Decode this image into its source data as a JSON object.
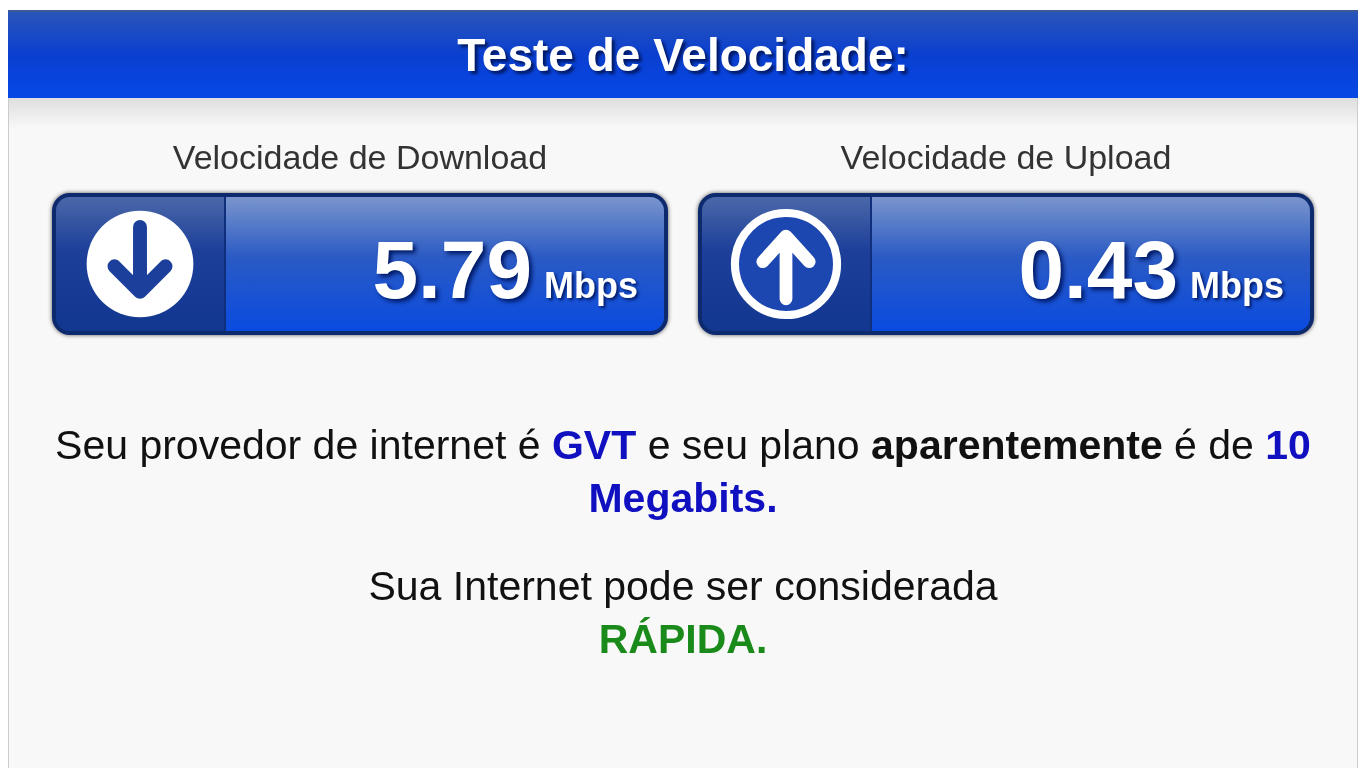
{
  "title": "Teste de Velocidade:",
  "meters": [
    {
      "kind": "download",
      "label": "Velocidade de Download",
      "value": "5.79",
      "unit": "Mbps"
    },
    {
      "kind": "upload",
      "label": "Velocidade de Upload",
      "value": "0.43",
      "unit": "Mbps"
    }
  ],
  "provider_message": [
    {
      "kind": "plain",
      "text": "Seu provedor de internet é "
    },
    {
      "kind": "link",
      "text": "GVT"
    },
    {
      "kind": "plain",
      "text": " e seu plano "
    },
    {
      "kind": "bold",
      "text": "aparentemente"
    },
    {
      "kind": "plain",
      "text": " é de "
    },
    {
      "kind": "link",
      "text": "10 Megabits."
    }
  ],
  "verdict": {
    "text": "Sua Internet pode ser considerada",
    "rating": "RÁPIDA."
  }
}
